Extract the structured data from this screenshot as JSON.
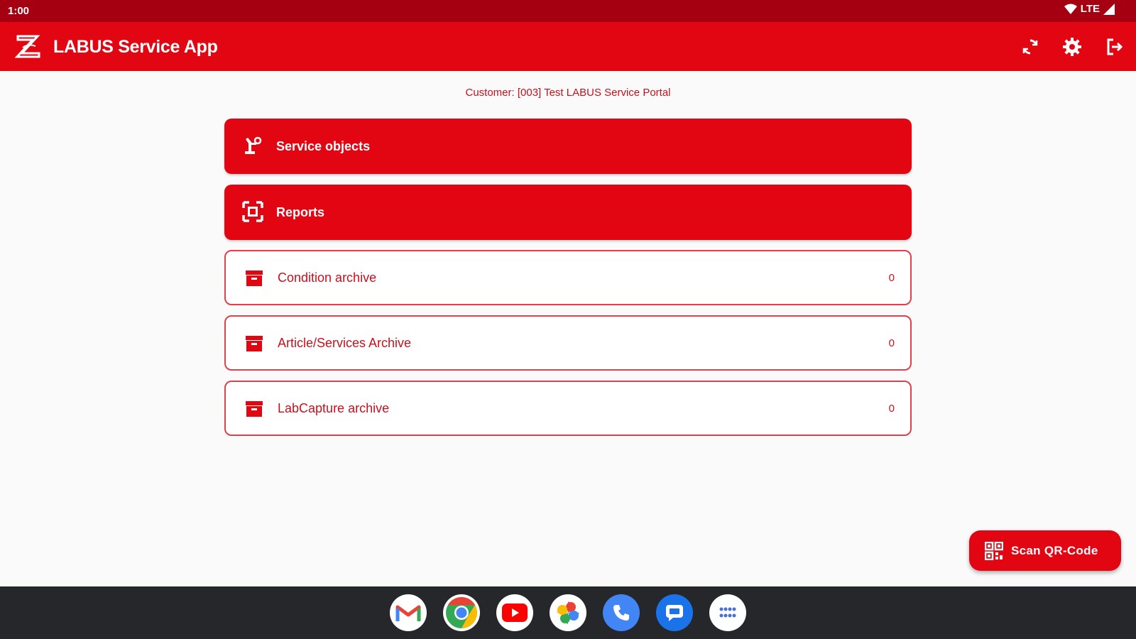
{
  "status_bar": {
    "time": "1:00",
    "network": "LTE"
  },
  "app_bar": {
    "title": "LABUS Service App",
    "actions": [
      {
        "name": "sync",
        "icon": "sync-icon"
      },
      {
        "name": "settings",
        "icon": "gear-icon"
      },
      {
        "name": "logout",
        "icon": "logout-icon"
      }
    ]
  },
  "customer_label": "Customer: [003] Test LABUS Service Portal",
  "menu": {
    "service_objects": {
      "label": "Service objects",
      "icon": "service-object-icon"
    },
    "reports": {
      "label": "Reports",
      "icon": "reports-icon"
    },
    "condition_archive": {
      "label": "Condition archive",
      "count": "0",
      "icon": "archive-icon"
    },
    "article_archive": {
      "label": "Article/Services Archive",
      "count": "0",
      "icon": "archive-icon"
    },
    "labcapture_archive": {
      "label": "LabCapture archive",
      "count": "0",
      "icon": "archive-icon"
    }
  },
  "fab": {
    "label": "Scan QR-Code",
    "icon": "qr-code-icon"
  },
  "dock": [
    "gmail-icon",
    "chrome-icon",
    "youtube-icon",
    "photos-icon",
    "phone-icon",
    "messages-icon",
    "app-drawer-icon"
  ],
  "colors": {
    "primary": "#e20613",
    "status_bar": "#a50011",
    "taskbar": "#25272b"
  }
}
